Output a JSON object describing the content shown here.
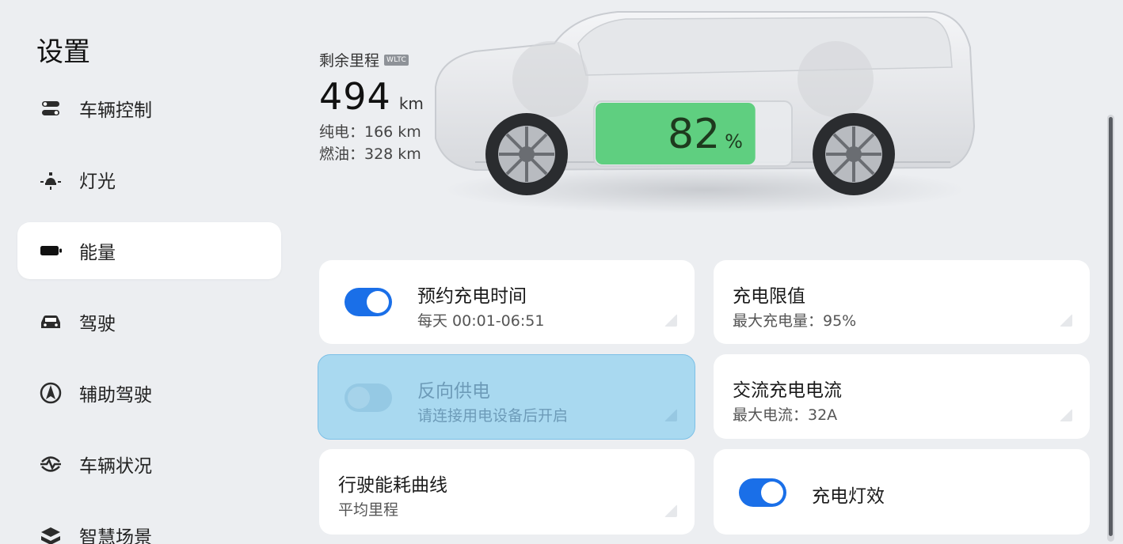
{
  "sidebar": {
    "title": "设置",
    "items": [
      {
        "label": "车辆控制",
        "icon": "vehicle-control-icon"
      },
      {
        "label": "灯光",
        "icon": "light-icon"
      },
      {
        "label": "能量",
        "icon": "battery-icon",
        "active": true
      },
      {
        "label": "驾驶",
        "icon": "car-icon"
      },
      {
        "label": "辅助驾驶",
        "icon": "assist-driving-icon"
      },
      {
        "label": "车辆状况",
        "icon": "vehicle-status-icon"
      },
      {
        "label": "智慧场景",
        "icon": "smart-scene-icon"
      }
    ]
  },
  "energy": {
    "range_label": "剩余里程",
    "range_badge": "WLTC",
    "range_value": "494",
    "range_unit": "km",
    "electric_line": "纯电：166 km",
    "fuel_line": "燃油：328 km",
    "battery_percent": "82",
    "battery_percent_unit": "%",
    "battery_level": 0.82
  },
  "cards": {
    "scheduled_charge": {
      "title": "预约充电时间",
      "subtitle": "每天 00:01-06:51",
      "toggle": true
    },
    "charge_limit": {
      "title": "充电限值",
      "subtitle": "最大充电量：95%"
    },
    "reverse_power": {
      "title": "反向供电",
      "subtitle": "请连接用电设备后开启",
      "toggle": false
    },
    "ac_current": {
      "title": "交流充电电流",
      "subtitle": "最大电流：32A"
    },
    "energy_curve": {
      "title": "行驶能耗曲线",
      "subtitle": "平均里程"
    },
    "charge_light": {
      "title": "充电灯效",
      "toggle": true
    }
  },
  "colors": {
    "accent": "#1a6fe8",
    "highlight": "#a9d9f0",
    "battery_green": "#5fcf80",
    "background": "#eceef1"
  }
}
